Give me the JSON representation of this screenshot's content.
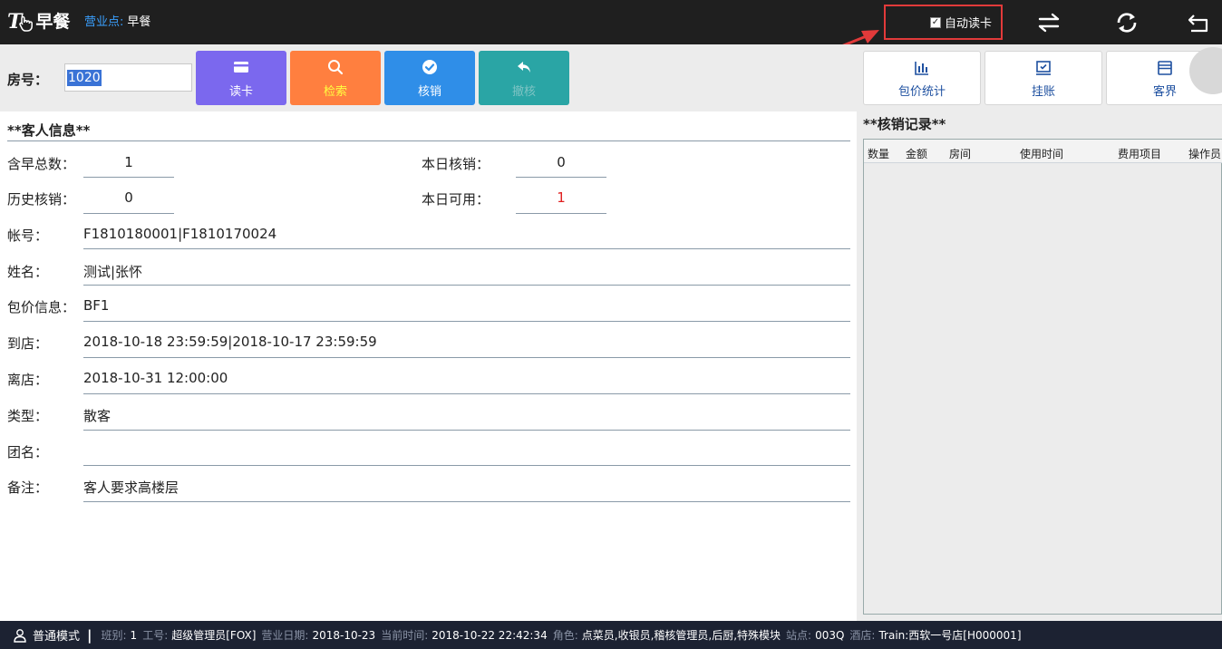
{
  "header": {
    "logo_mark": "T",
    "logo_text": "早餐",
    "biz_point_label": "营业点:",
    "biz_point_value": "早餐",
    "auto_read_checked": true,
    "auto_read_label": "自动读卡",
    "icons": [
      "swap-icon",
      "refresh-icon",
      "back-icon"
    ]
  },
  "toolbar": {
    "room_label": "房号：",
    "room_value": "1020",
    "buttons": [
      {
        "label": "读卡",
        "icon": "card-icon",
        "color": "#7b68ee",
        "text_color": "#ffffff"
      },
      {
        "label": "检索",
        "icon": "search-icon",
        "color": "#ff7f3f",
        "text_color": "#ffff40"
      },
      {
        "label": "核销",
        "icon": "check-circle-icon",
        "color": "#2f8ee8",
        "text_color": "#ffffff"
      },
      {
        "label": "撤核",
        "icon": "undo-icon",
        "color": "#2aa5a5",
        "text_color": "#7fc4c4"
      }
    ]
  },
  "guest": {
    "section_title": "**客人信息**",
    "fields": {
      "total_breakfast_label": "含早总数：",
      "total_breakfast_value": "1",
      "today_used_label": "本日核销：",
      "today_used_value": "0",
      "history_used_label": "历史核销：",
      "history_used_value": "0",
      "today_available_label": "本日可用：",
      "today_available_value": "1",
      "account_label": "帐号：",
      "account_value": "F1810180001|F1810170024",
      "name_label": "姓名：",
      "name_value": "测试|张怀",
      "package_label": "包价信息：",
      "package_value": "BF1",
      "arrival_label": "到店：",
      "arrival_value": "2018-10-18 23:59:59|2018-10-17 23:59:59",
      "departure_label": "离店：",
      "departure_value": "2018-10-31 12:00:00",
      "type_label": "类型：",
      "type_value": "散客",
      "group_label": "团名：",
      "group_value": "",
      "remark_label": "备注：",
      "remark_value": "客人要求高楼层"
    }
  },
  "right_buttons": [
    {
      "label": "包价统计",
      "icon": "bar-chart-icon"
    },
    {
      "label": "挂账",
      "icon": "monitor-check-icon"
    },
    {
      "label": "客界",
      "icon": "window-icon"
    }
  ],
  "records": {
    "title": "**核销记录**",
    "columns": [
      "数量",
      "金额",
      "房间",
      "使用时间",
      "费用项目",
      "操作员"
    ],
    "rows": []
  },
  "status_bar": {
    "mode": "普通模式",
    "separator": "|",
    "shift_label": "班别:",
    "shift_value": "1",
    "staff_label": "工号:",
    "staff_value": "超级管理员[FOX]",
    "biz_date_label": "营业日期:",
    "biz_date_value": "2018-10-23",
    "now_label": "当前时间:",
    "now_value": "2018-10-22 22:42:34",
    "role_label": "角色:",
    "role_value": "点菜员,收银员,稽核管理员,后厨,特殊模块",
    "station_label": "站点:",
    "station_value": "003Q",
    "hotel_label": "酒店:",
    "hotel_value": "Train:西软一号店[H000001]"
  },
  "colors": {
    "topbar": "#1f1f1f",
    "highlight_box": "#e23a3a",
    "available_value": "#e02020",
    "status_bar": "#1c2232"
  }
}
